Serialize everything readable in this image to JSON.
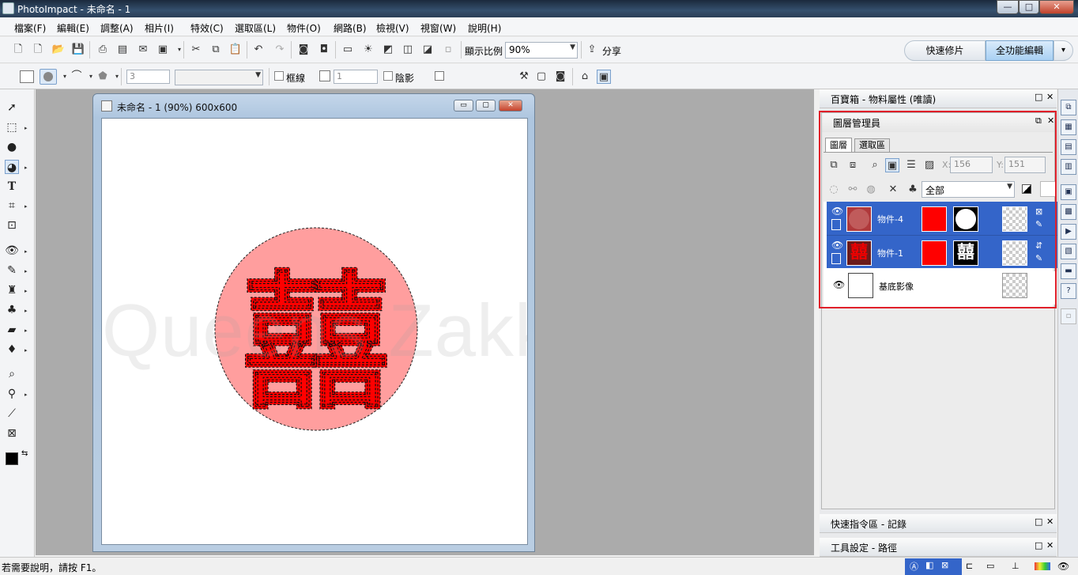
{
  "app": {
    "title": "PhotoImpact - 未命名 - 1"
  },
  "window_buttons": {
    "minimize": "—",
    "maximize": "□",
    "close": "✕"
  },
  "menu": [
    "檔案(F)",
    "編輯(E)",
    "調整(A)",
    "相片(I)",
    "特效(C)",
    "選取區(L)",
    "物件(O)",
    "網路(B)",
    "檢視(V)",
    "視窗(W)",
    "說明(H)"
  ],
  "toolbar": {
    "zoom_label": "顯示比例",
    "zoom_value": "90%",
    "share_label": "分享"
  },
  "modes": {
    "quick": "快速修片",
    "full": "全功能編輯",
    "arrow": "▾"
  },
  "toolbar2": {
    "width_value": "3",
    "frame_label": "框線",
    "frame_value": "1",
    "shadow_label": "陰影"
  },
  "document": {
    "title": "未命名 - 1 (90%) 600x600",
    "watermark": "Queens Zakka",
    "glyph": "囍",
    "min": "▭",
    "max": "▢",
    "close": "✕"
  },
  "panels": {
    "library_title": "百寶箱 - 物料屬性 (唯讀)",
    "layer_manager_title": "圖層管理員",
    "tab_layers": "圖層",
    "tab_selection": "選取區",
    "x_label": "X:",
    "x_value": "156",
    "y_label": "Y:",
    "y_value": "151",
    "filter_value": "全部",
    "quick_command_title": "快速指令區 - 記錄",
    "tool_settings_title": "工具設定 - 路徑",
    "pin": "□",
    "close": "✕",
    "restore": "⧉"
  },
  "layers": [
    {
      "name": "物件-4",
      "selected": true
    },
    {
      "name": "物件-1",
      "selected": true
    },
    {
      "name": "基底影像",
      "selected": false
    }
  ],
  "layer_glyph": "囍",
  "status": {
    "help_text": "若需要說明，請按 F1。"
  },
  "colors": {
    "accent_selected": "#3465c9",
    "highlight_border": "#e0202a",
    "stamp_red": "#ff0000",
    "circle_fill": "#ff9e9e"
  }
}
